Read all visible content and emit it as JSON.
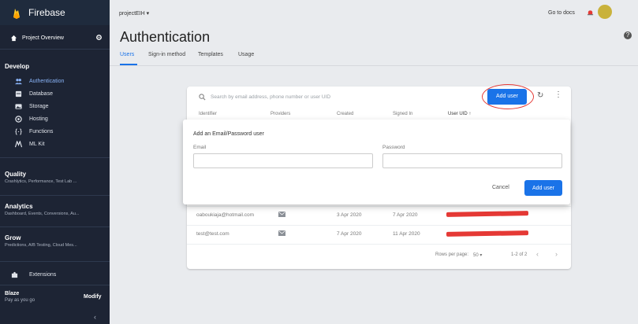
{
  "sidebar": {
    "brand": "Firebase",
    "overview_label": "Project Overview",
    "sections": [
      {
        "title": "Develop",
        "subtitle": ""
      },
      {
        "title": "Quality",
        "subtitle": "Crashlytics, Performance, Test Lab ..."
      },
      {
        "title": "Analytics",
        "subtitle": "Dashboard, Events, Conversions, Au..."
      },
      {
        "title": "Grow",
        "subtitle": "Predictions, A/B Testing, Cloud Mes..."
      }
    ],
    "develop_items": [
      {
        "label": "Authentication",
        "icon": "people-icon",
        "active": true
      },
      {
        "label": "Database",
        "icon": "database-icon",
        "active": false
      },
      {
        "label": "Storage",
        "icon": "image-icon",
        "active": false
      },
      {
        "label": "Hosting",
        "icon": "globe-icon",
        "active": false
      },
      {
        "label": "Functions",
        "icon": "braces-icon",
        "active": false
      },
      {
        "label": "ML Kit",
        "icon": "ml-icon",
        "active": false
      }
    ],
    "extensions_label": "Extensions",
    "plan_name": "Blaze",
    "plan_desc": "Pay as you go",
    "modify_label": "Modify",
    "collapse_glyph": "‹"
  },
  "topbar": {
    "project": "projectEIH ▾",
    "docs": "Go to docs",
    "help_glyph": "?"
  },
  "page": {
    "title": "Authentication",
    "tabs": [
      "Users",
      "Sign-in method",
      "Templates",
      "Usage"
    ]
  },
  "users_card": {
    "search_placeholder": "Search by email address, phone number or user UID",
    "add_user_label": "Add user",
    "refresh_glyph": "↻",
    "more_glyph": "⋮",
    "headers": [
      "Identifier",
      "Providers",
      "Created",
      "Signed In",
      "User UID ↑"
    ],
    "rows": [
      {
        "identifier": "oaboukiaja@hotmail.com",
        "created": "3 Apr 2020",
        "signed_in": "7 Apr 2020"
      },
      {
        "identifier": "test@test.com",
        "created": "7 Apr 2020",
        "signed_in": "11 Apr 2020"
      }
    ],
    "rows_per_page_label": "Rows per page:",
    "rows_per_page_value": "50 ▾",
    "range": "1-2 of 2",
    "prev_glyph": "‹",
    "next_glyph": "›"
  },
  "add_dialog": {
    "title": "Add an Email/Password user",
    "email_label": "Email",
    "password_label": "Password",
    "email_value": "",
    "password_value": "",
    "cancel_label": "Cancel",
    "submit_label": "Add user"
  },
  "colors": {
    "accent": "#1a73e8",
    "sidebar": "#1d2434",
    "annotation": "#e53935"
  }
}
